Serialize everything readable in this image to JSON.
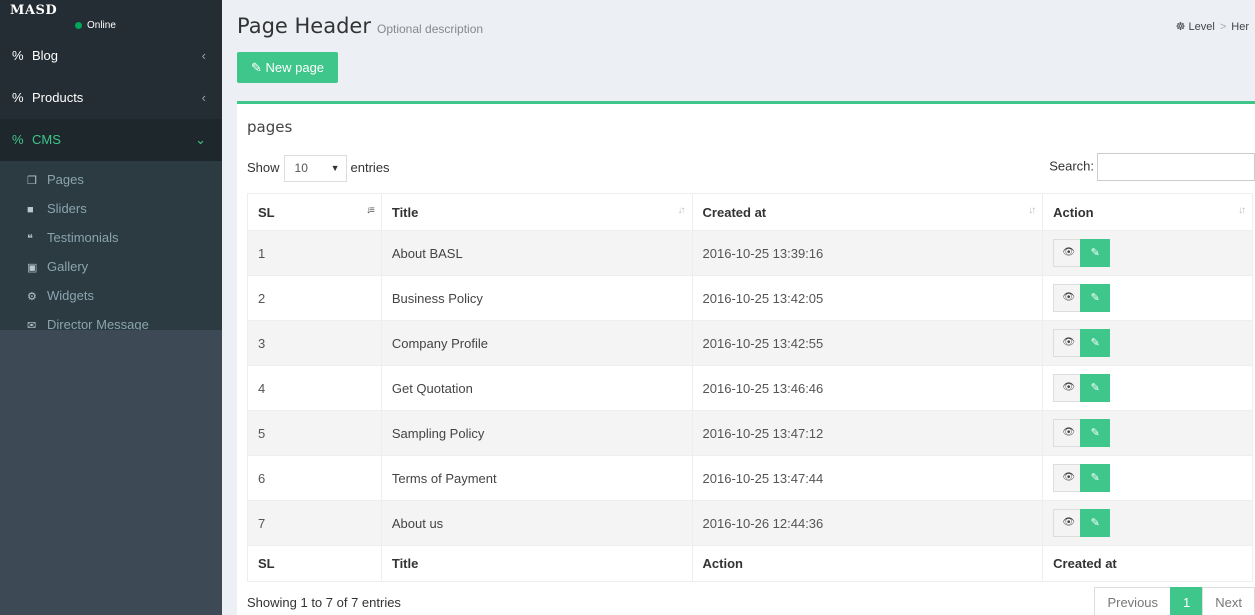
{
  "sidebar": {
    "logo": "MASD",
    "status": "Online",
    "items": [
      {
        "label": "Blog",
        "icon": "link-icon"
      },
      {
        "label": "Products",
        "icon": "link-icon"
      },
      {
        "label": "CMS",
        "icon": "link-icon"
      }
    ],
    "submenu": [
      {
        "label": "Pages",
        "icon": "pages-icon"
      },
      {
        "label": "Sliders",
        "icon": "file-icon"
      },
      {
        "label": "Testimonials",
        "icon": "quote-icon"
      },
      {
        "label": "Gallery",
        "icon": "image-icon"
      },
      {
        "label": "Widgets",
        "icon": "cogs-icon"
      },
      {
        "label": "Director Message",
        "icon": "envelope-icon"
      }
    ]
  },
  "header": {
    "title": "Page Header",
    "description": "Optional description",
    "breadcrumb": [
      "Level",
      "Her"
    ],
    "new_button": "New page"
  },
  "box": {
    "title": "pages",
    "show_label": "Show",
    "entries_value": "10",
    "entries_label": "entries",
    "search_label": "Search:",
    "search_value": ""
  },
  "table": {
    "headers": [
      "SL",
      "Title",
      "Created at",
      "Action"
    ],
    "footers": [
      "SL",
      "Title",
      "Action",
      "Created at"
    ],
    "rows": [
      {
        "sl": "1",
        "title": "About BASL",
        "created": "2016-10-25 13:39:16"
      },
      {
        "sl": "2",
        "title": "Business Policy",
        "created": "2016-10-25 13:42:05"
      },
      {
        "sl": "3",
        "title": "Company Profile",
        "created": "2016-10-25 13:42:55"
      },
      {
        "sl": "4",
        "title": "Get Quotation",
        "created": "2016-10-25 13:46:46"
      },
      {
        "sl": "5",
        "title": "Sampling Policy",
        "created": "2016-10-25 13:47:12"
      },
      {
        "sl": "6",
        "title": "Terms of Payment",
        "created": "2016-10-25 13:47:44"
      },
      {
        "sl": "7",
        "title": "About us",
        "created": "2016-10-26 12:44:36"
      }
    ]
  },
  "footer": {
    "info": "Showing 1 to 7 of 7 entries",
    "prev": "Previous",
    "page": "1",
    "next": "Next"
  },
  "colors": {
    "accent": "#3fc68a",
    "sidebar": "#3d4a55"
  }
}
